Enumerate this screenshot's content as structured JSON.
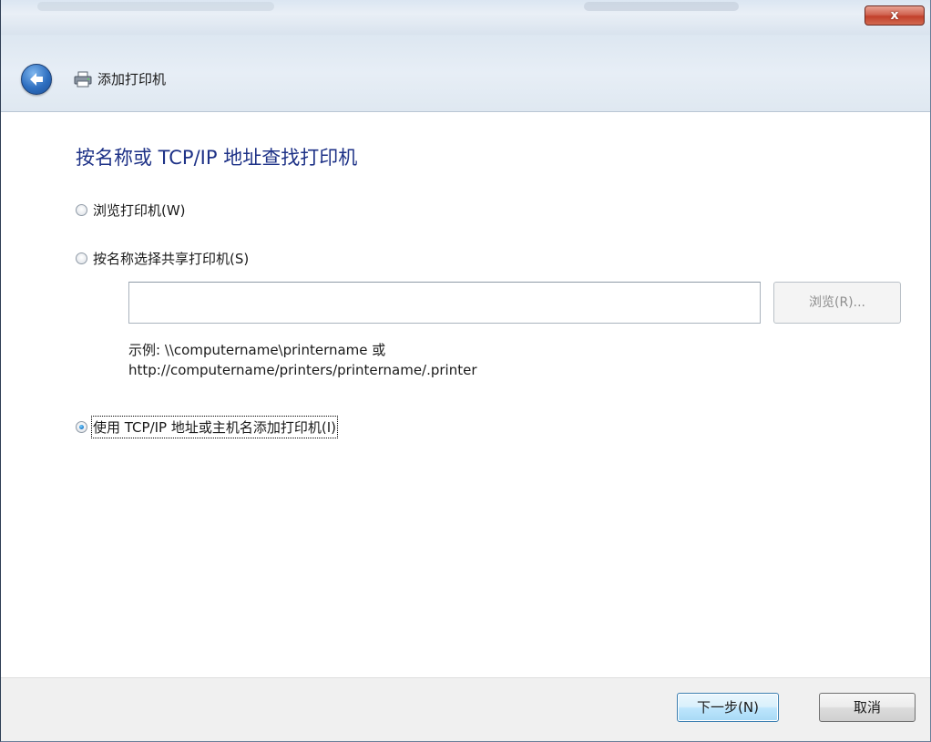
{
  "window": {
    "close_label": "x"
  },
  "nav": {
    "title": "添加打印机"
  },
  "main": {
    "heading": "按名称或 TCP/IP 地址查找打印机",
    "options": [
      {
        "label": "浏览打印机(W)",
        "selected": false
      },
      {
        "label": "按名称选择共享打印机(S)",
        "selected": false
      },
      {
        "label": "使用 TCP/IP 地址或主机名添加打印机(I)",
        "selected": true
      }
    ],
    "share_input": {
      "value": ""
    },
    "browse_label": "浏览(R)...",
    "example_line1": "示例: \\\\computername\\printername 或",
    "example_line2": "http://computername/printers/printername/.printer"
  },
  "footer": {
    "next_label": "下一步(N)",
    "cancel_label": "取消"
  },
  "colors": {
    "heading": "#1e3287",
    "next_button_border": "#3c7fb1",
    "close_button": "#c2402b"
  }
}
